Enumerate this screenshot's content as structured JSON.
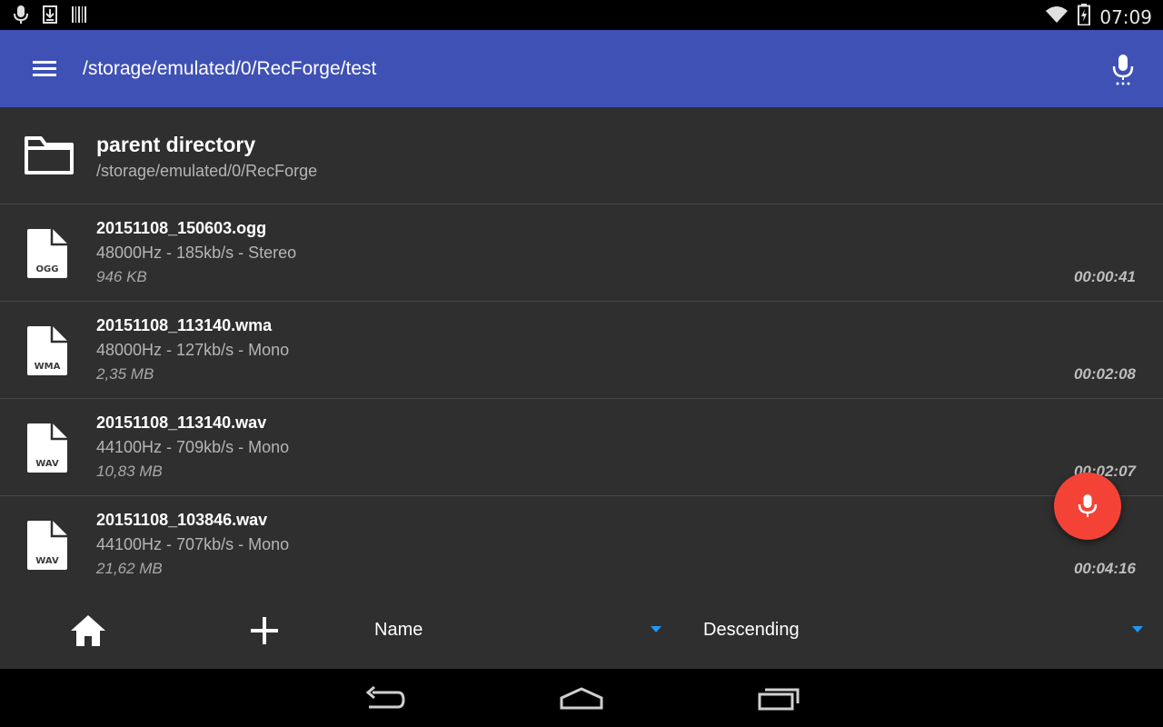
{
  "status_bar": {
    "time": "07:09",
    "left_icons": [
      "mic-icon",
      "download-icon",
      "barcode-icon"
    ],
    "right_icons": [
      "wifi-icon",
      "battery-charging-icon"
    ]
  },
  "app_bar": {
    "title": "/storage/emulated/0/RecForge/test",
    "menu_icon": "menu-icon",
    "action_icon": "mic-icon"
  },
  "parent_row": {
    "name": "parent directory",
    "path": "/storage/emulated/0/RecForge",
    "icon": "folder-icon"
  },
  "files": [
    {
      "ext": "OGG",
      "name": "20151108_150603.ogg",
      "info": "48000Hz - 185kb/s - Stereo",
      "size": "946 KB",
      "duration": "00:00:41"
    },
    {
      "ext": "WMA",
      "name": "20151108_113140.wma",
      "info": "48000Hz - 127kb/s - Mono",
      "size": "2,35 MB",
      "duration": "00:02:08"
    },
    {
      "ext": "WAV",
      "name": "20151108_113140.wav",
      "info": "44100Hz - 709kb/s - Mono",
      "size": "10,83 MB",
      "duration": "00:02:07"
    },
    {
      "ext": "WAV",
      "name": "20151108_103846.wav",
      "info": "44100Hz - 707kb/s - Mono",
      "size": "21,62 MB",
      "duration": "00:04:16"
    }
  ],
  "toolbar": {
    "sort_by": "Name",
    "order": "Descending"
  },
  "colors": {
    "app_bar": "#3f51b5",
    "fab": "#f44336",
    "spinner_caret": "#2196f3",
    "background": "#2f2f2f"
  }
}
